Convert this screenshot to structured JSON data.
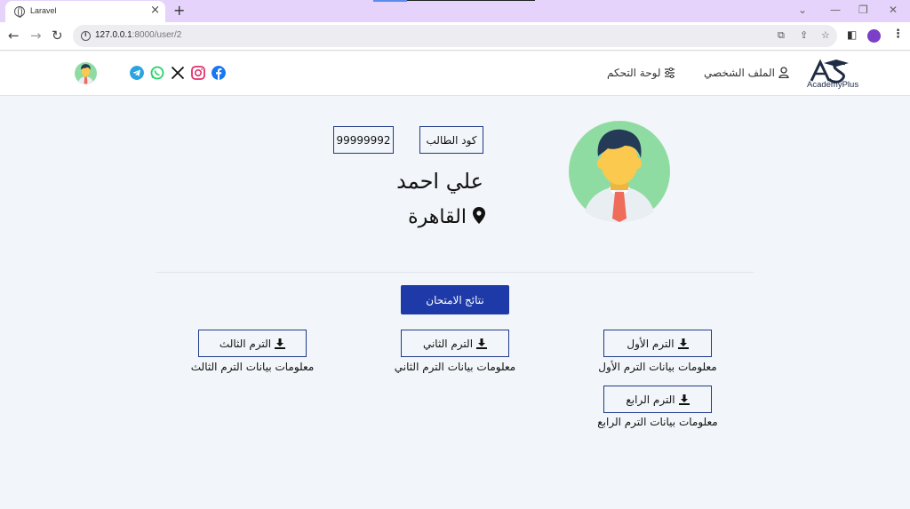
{
  "browser": {
    "tab_title": "Laravel",
    "url_host": "127.0.0.1",
    "url_path": ":8000/user/2"
  },
  "nav": {
    "logo_text": "AcademyPlus",
    "profile_link": "الملف الشخصي",
    "dashboard_link": "لوحة التحكم",
    "social": [
      "facebook-icon",
      "instagram-icon",
      "x-icon",
      "whatsapp-icon",
      "telegram-icon"
    ]
  },
  "student": {
    "code_label": "كود الطالب",
    "code_value": "99999992",
    "name": "علي احمد",
    "city": "القاهرة"
  },
  "exam_results_label": "نتائج الامتحان",
  "terms": [
    {
      "label": "الترم الأول",
      "caption": "معلومات بيانات الترم الأول"
    },
    {
      "label": "الترم الثاني",
      "caption": "معلومات بيانات الترم الثاني"
    },
    {
      "label": "الترم الثالث",
      "caption": "معلومات بيانات الترم الثالث"
    },
    {
      "label": "الترم الرابع",
      "caption": "معلومات بيانات الترم الرابع"
    }
  ],
  "colors": {
    "primary": "#1e3aa8",
    "page_bg": "#f2f5f9",
    "tabbar_bg": "#e5d3fb"
  }
}
